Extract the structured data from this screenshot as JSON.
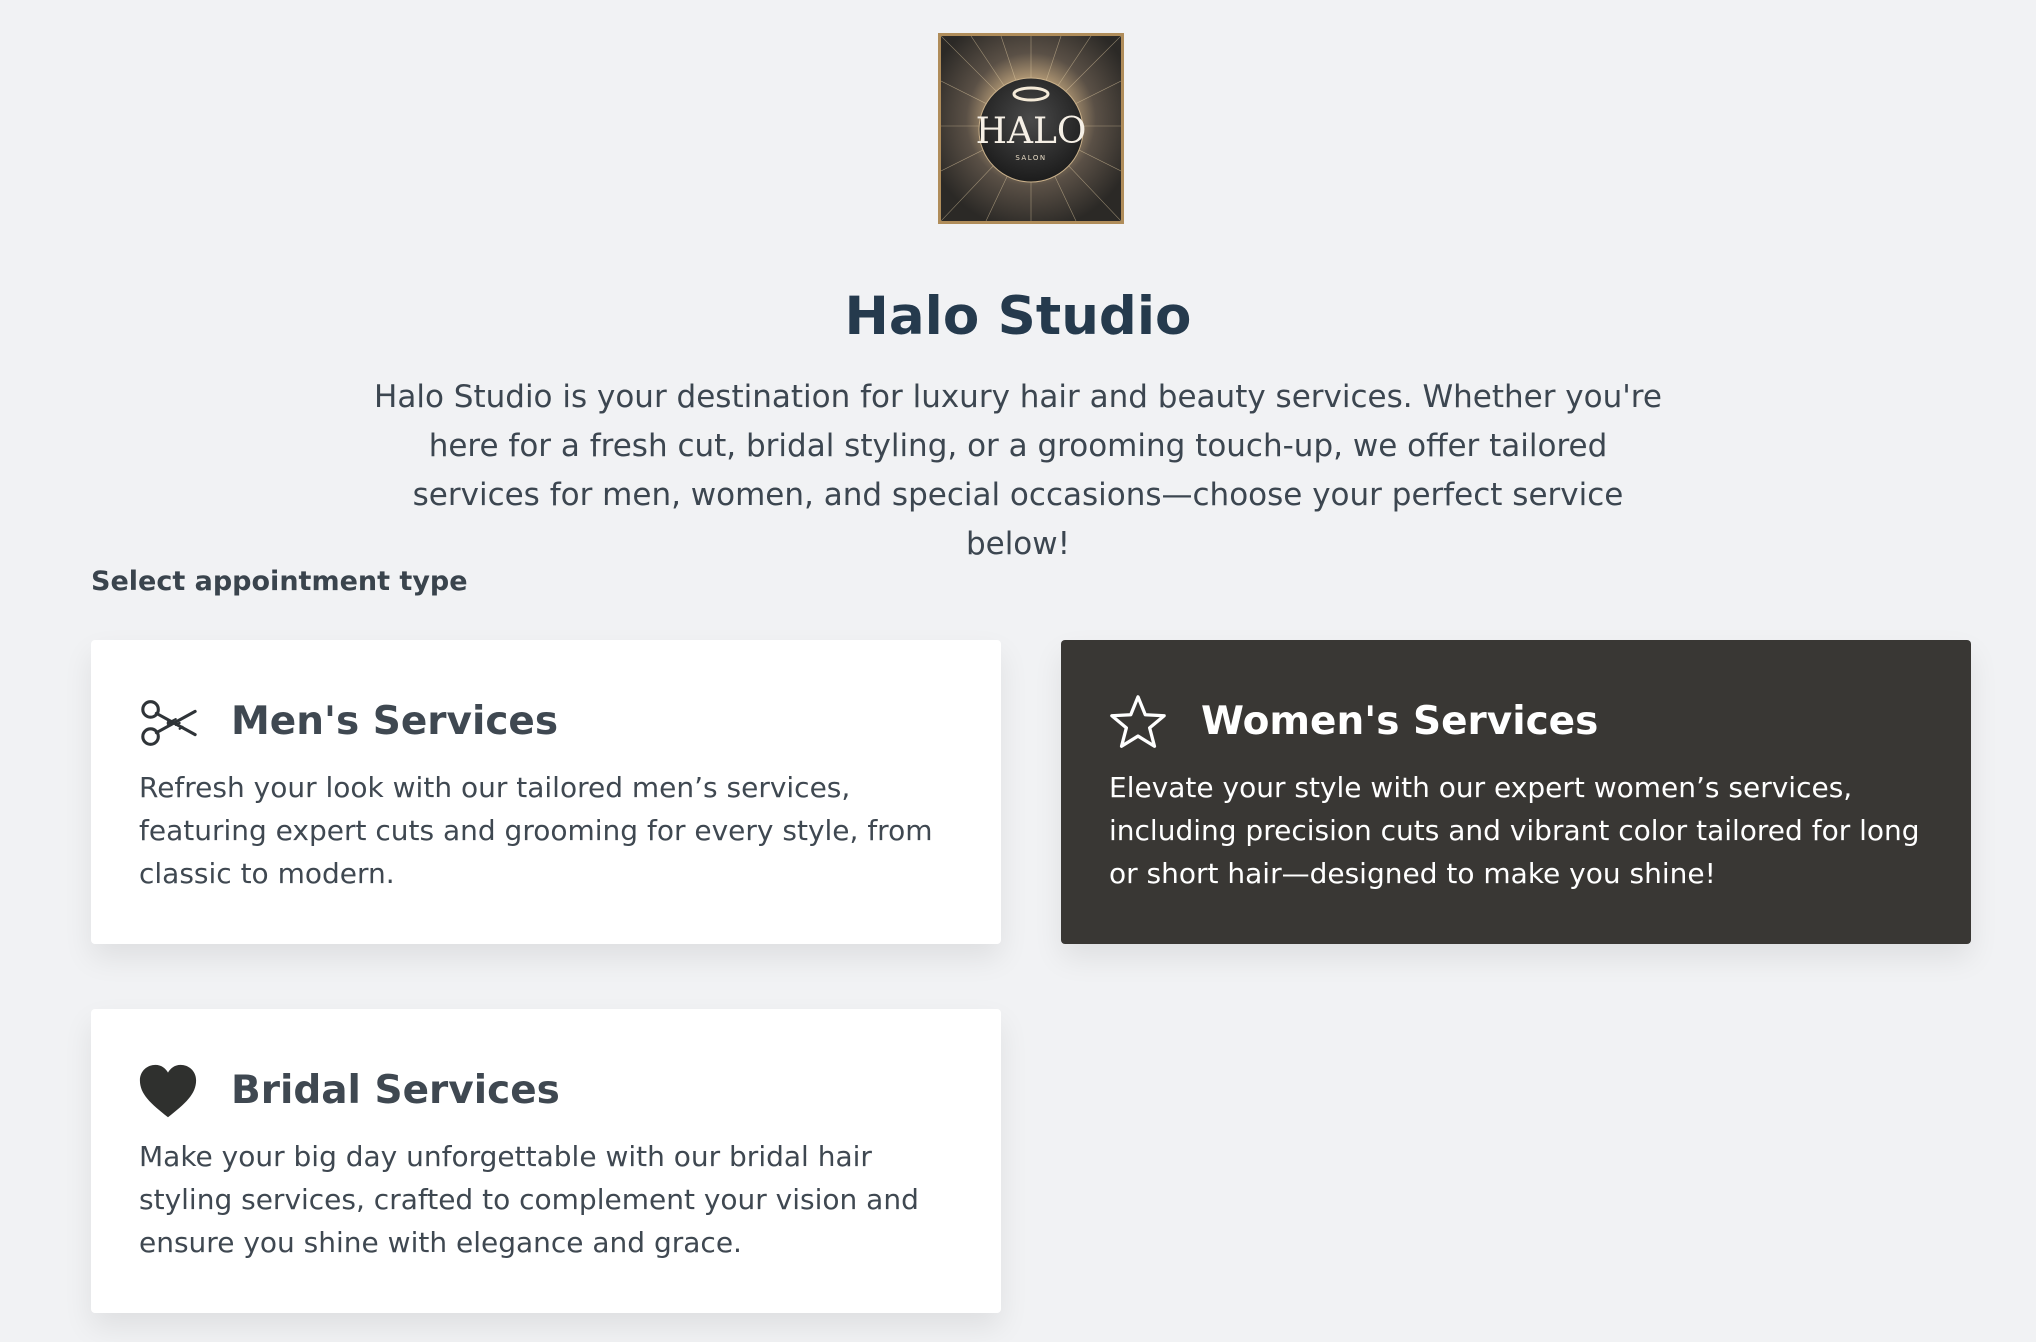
{
  "logo": {
    "text": "HALO",
    "subtext": "SALON"
  },
  "header": {
    "title": "Halo Studio",
    "description": "Halo Studio is your destination for luxury hair and beauty services. Whether you're here for a fresh cut, bridal styling, or a grooming touch-up, we offer tailored services for men, women, and special occasions—choose your perfect service below!"
  },
  "appointment": {
    "label": "Select appointment type",
    "selected": "Women's Services",
    "options": [
      {
        "title": "Men's Services",
        "icon": "scissors-icon",
        "description": "Refresh your look with our tailored men’s services, featuring expert cuts and grooming for every style, from classic to modern."
      },
      {
        "title": "Women's Services",
        "icon": "star-icon",
        "description": "Elevate your style with our expert women’s services, including precision cuts and vibrant color tailored for long or short hair—designed to make you shine!"
      },
      {
        "title": "Bridal Services",
        "icon": "heart-icon",
        "description": "Make your big day unforgettable with our bridal hair styling services, crafted to complement your vision and ensure you shine with elegance and grace."
      }
    ]
  },
  "colors": {
    "background": "#f1f2f4",
    "card": "#ffffff",
    "selected_card": "#393734",
    "title": "#253a4d",
    "logo_border": "#b08d5a"
  }
}
